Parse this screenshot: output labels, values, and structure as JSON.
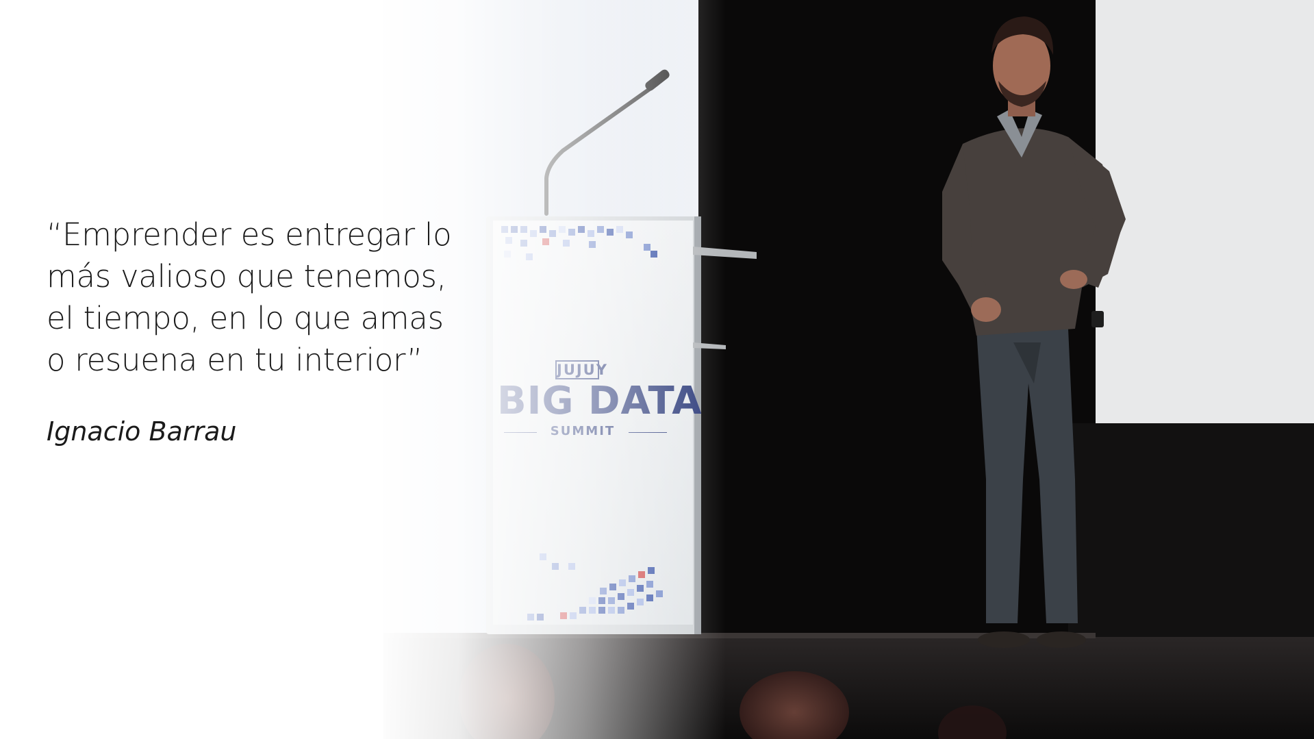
{
  "quote": {
    "lines": [
      "“Emprender es entregar lo",
      "más valioso que tenemos,",
      "el tiempo, en lo que amas",
      "o resuena en tu interior”"
    ],
    "author": "Ignacio Barrau"
  },
  "photo": {
    "podium_screen": {
      "line1": "JUJUY",
      "line2": "BIG DATA",
      "line3": "SUMMIT"
    }
  }
}
